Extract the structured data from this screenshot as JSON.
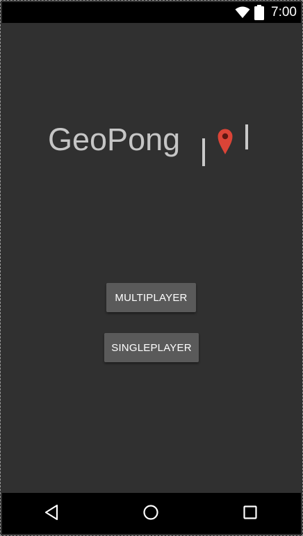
{
  "status_bar": {
    "time": "7:00",
    "icons": [
      "wifi-icon",
      "battery-icon"
    ]
  },
  "app": {
    "title": "GeoPong",
    "pin_icon": "location-pin-icon",
    "colors": {
      "background": "#303030",
      "title": "#c6c6c6",
      "pin": "#db4437",
      "button": "#5a5a5a"
    }
  },
  "buttons": {
    "multiplayer": "MULTIPLAYER",
    "singleplayer": "SINGLEPLAYER"
  },
  "nav_bar": {
    "icons": [
      "back-icon",
      "home-icon",
      "recents-icon"
    ]
  }
}
